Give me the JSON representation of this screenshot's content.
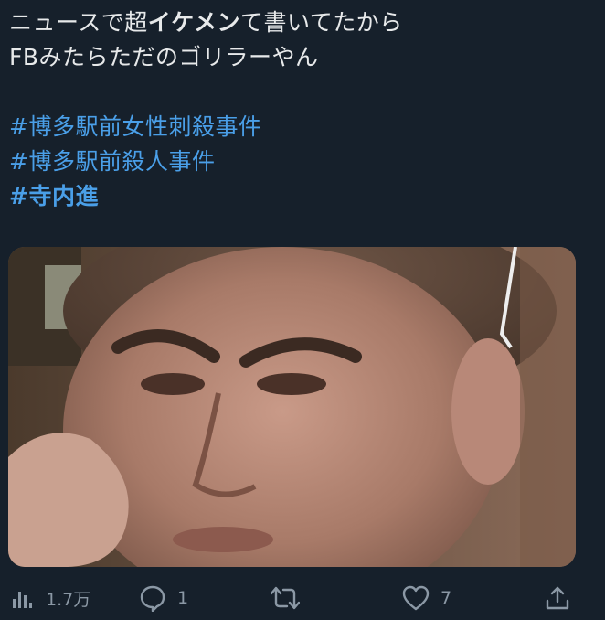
{
  "tweet": {
    "lines": [
      {
        "segments": [
          {
            "text": "ニュースで超"
          },
          {
            "text": "イケメン",
            "bold": true
          },
          {
            "text": "て書いてたから"
          }
        ]
      },
      {
        "segments": [
          {
            "text": "FBみたらただのゴリラーやん"
          }
        ]
      }
    ],
    "hashtags": [
      {
        "text": "#博多駅前女性刺殺事件",
        "bold": false
      },
      {
        "text": "#博多駅前殺人事件",
        "bold": false
      },
      {
        "text": "#寺内進",
        "bold": true
      }
    ]
  },
  "actions": {
    "views": {
      "icon": "analytics-icon",
      "count": "1.7万"
    },
    "reply": {
      "icon": "reply-icon",
      "count": "1"
    },
    "retweet": {
      "icon": "retweet-icon",
      "count": ""
    },
    "like": {
      "icon": "like-icon",
      "count": "7"
    },
    "share": {
      "icon": "share-icon",
      "count": ""
    }
  },
  "colors": {
    "background": "#16202b",
    "text": "#e7e9ea",
    "hashtag": "#4a9fe8",
    "icon": "#8b98a5"
  }
}
